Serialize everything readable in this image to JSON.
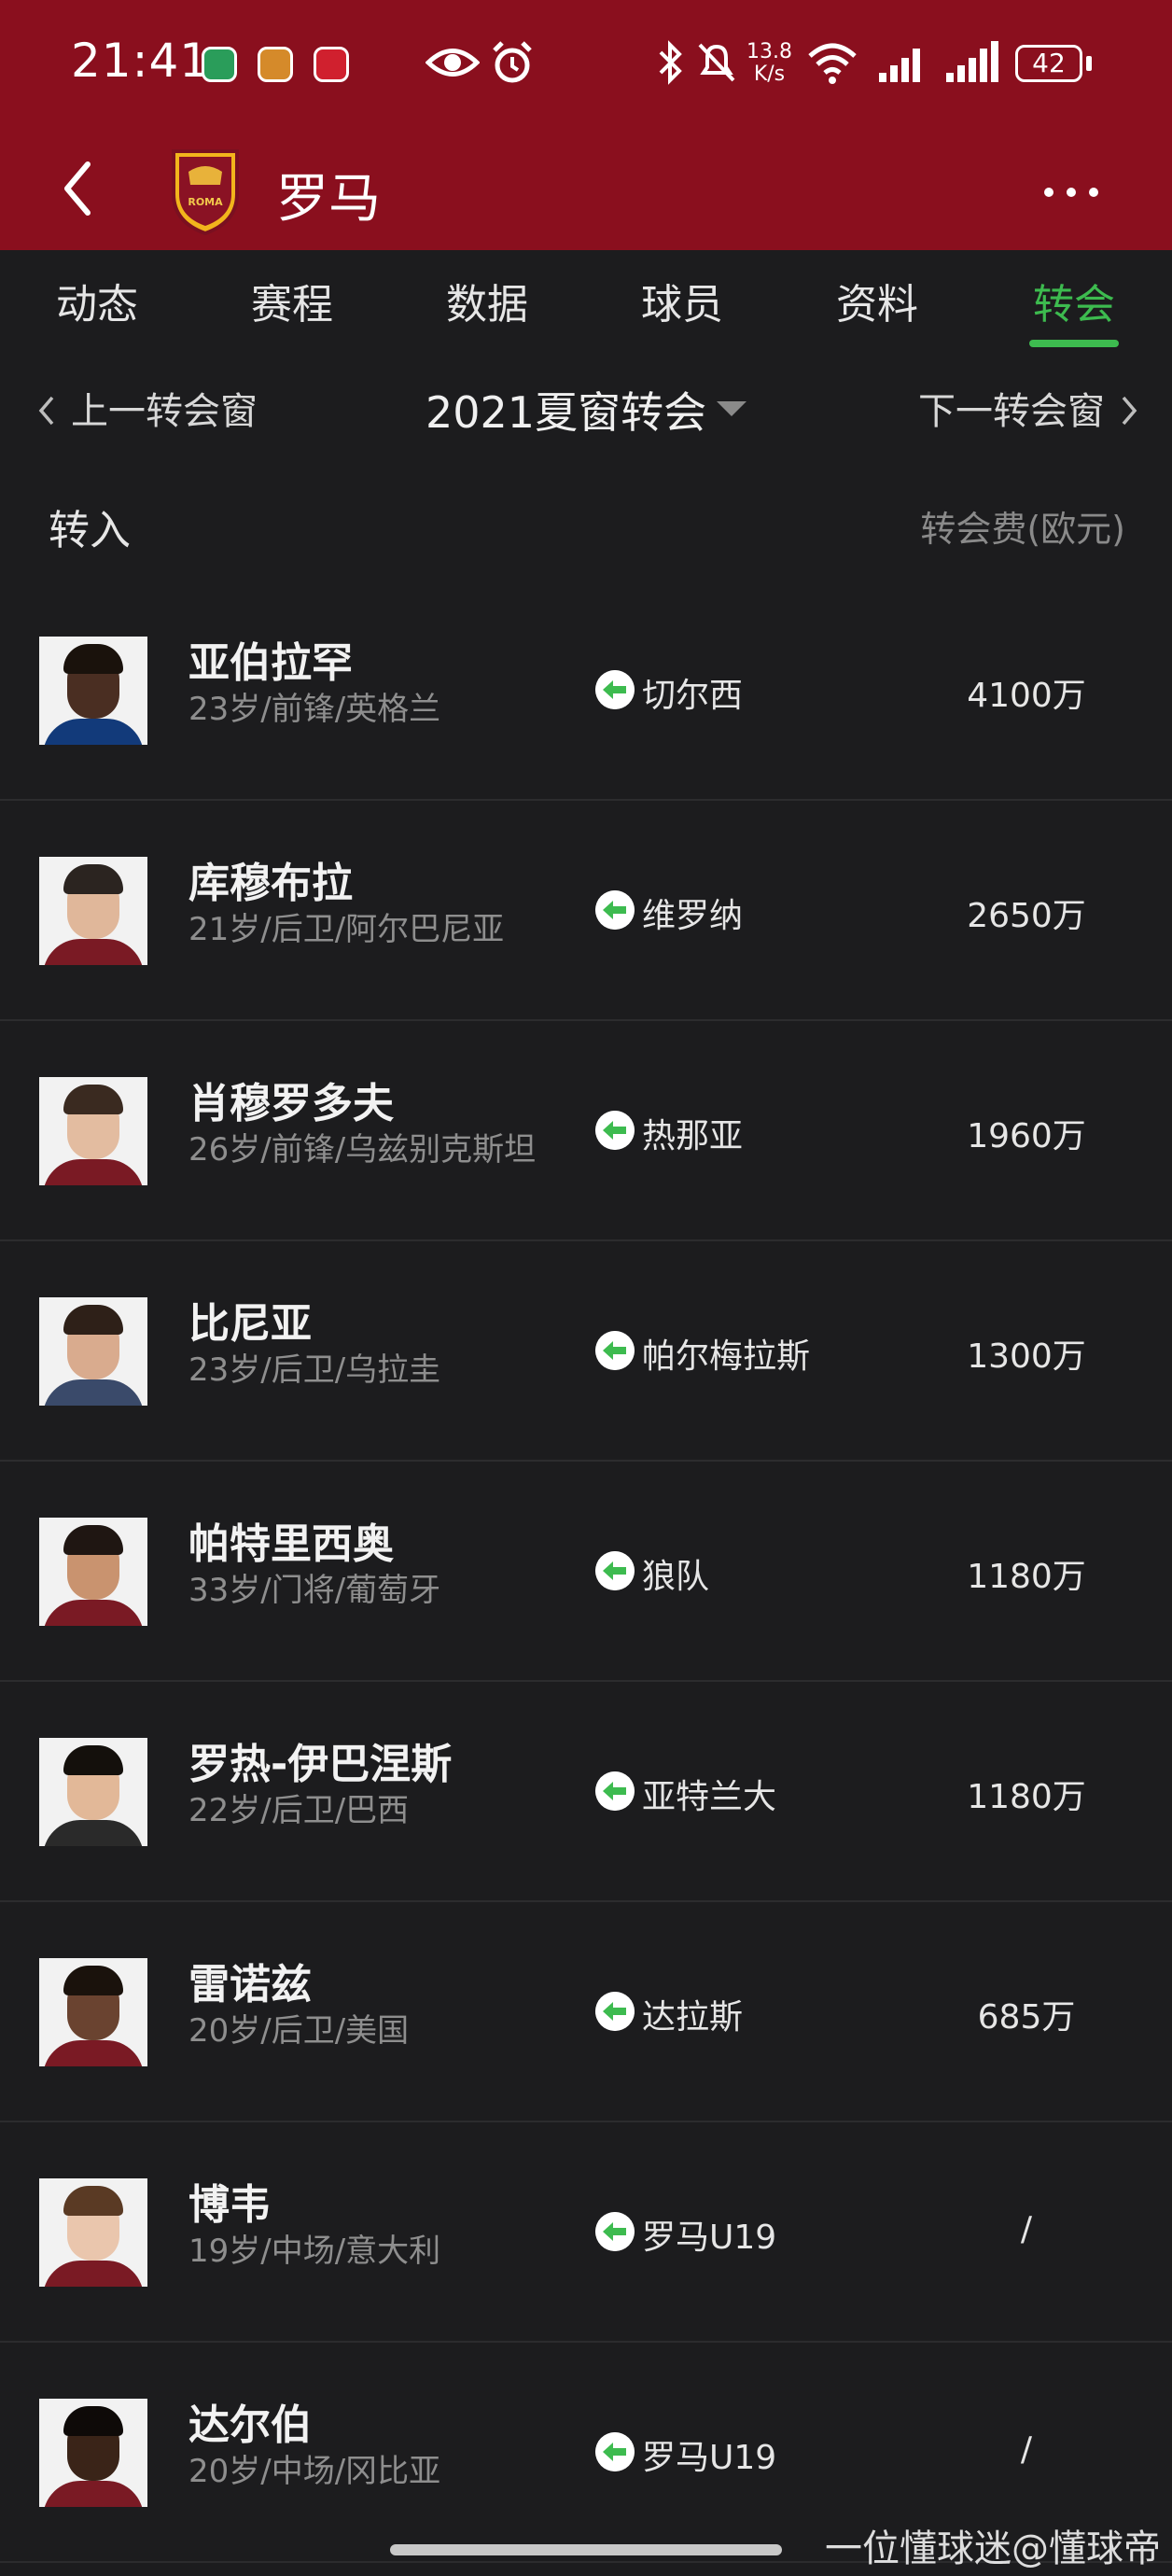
{
  "status_bar": {
    "time": "21:41",
    "net_speed_value": "13.8",
    "net_speed_unit": "K/s",
    "battery": "42"
  },
  "header": {
    "club_name": "罗马",
    "logo_text": "ROMA"
  },
  "tabs": [
    {
      "label": "动态",
      "active": false
    },
    {
      "label": "赛程",
      "active": false
    },
    {
      "label": "数据",
      "active": false
    },
    {
      "label": "球员",
      "active": false
    },
    {
      "label": "资料",
      "active": false
    },
    {
      "label": "转会",
      "active": true
    }
  ],
  "window_selector": {
    "prev_label": "上一转会窗",
    "title": "2021夏窗转会",
    "next_label": "下一转会窗"
  },
  "section": {
    "title": "转入",
    "fee_header": "转会费(欧元)"
  },
  "transfers": [
    {
      "name": "亚伯拉罕",
      "info": "23岁/前锋/英格兰",
      "from": "切尔西",
      "fee": "4100万"
    },
    {
      "name": "库穆布拉",
      "info": "21岁/后卫/阿尔巴尼亚",
      "from": "维罗纳",
      "fee": "2650万"
    },
    {
      "name": "肖穆罗多夫",
      "info": "26岁/前锋/乌兹别克斯坦",
      "from": "热那亚",
      "fee": "1960万"
    },
    {
      "name": "比尼亚",
      "info": "23岁/后卫/乌拉圭",
      "from": "帕尔梅拉斯",
      "fee": "1300万"
    },
    {
      "name": "帕特里西奥",
      "info": "33岁/门将/葡萄牙",
      "from": "狼队",
      "fee": "1180万"
    },
    {
      "name": "罗热-伊巴涅斯",
      "info": "22岁/后卫/巴西",
      "from": "亚特兰大",
      "fee": "1180万"
    },
    {
      "name": "雷诺兹",
      "info": "20岁/后卫/美国",
      "from": "达拉斯",
      "fee": "685万"
    },
    {
      "name": "博韦",
      "info": "19岁/中场/意大利",
      "from": "罗马U19",
      "fee": "/"
    },
    {
      "name": "达尔伯",
      "info": "20岁/中场/冈比亚",
      "from": "罗马U19",
      "fee": "/"
    }
  ],
  "watermark": "一位懂球迷@懂球帝",
  "colors": {
    "header_bg": "#8a0f1e",
    "accent_green": "#3dbb4f",
    "page_bg": "#1c1c1e"
  }
}
